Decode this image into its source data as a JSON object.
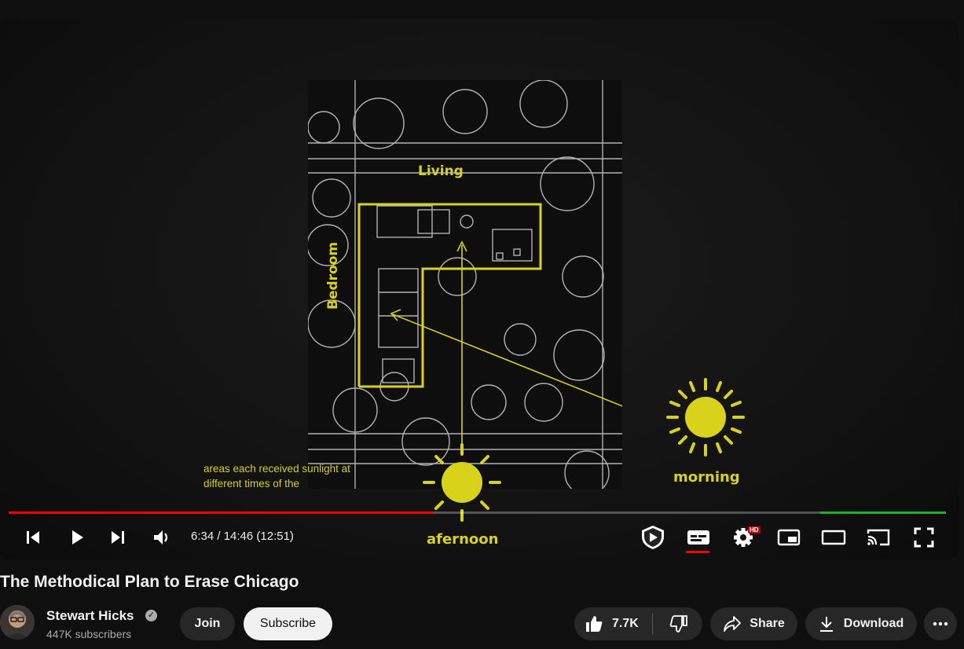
{
  "video": {
    "caption_line1": "areas each received sunlight at",
    "caption_line2": "different times of the",
    "labels": {
      "living": "Living",
      "bedroom": "Bedroom",
      "morning": "morning",
      "afternoon": "afernoon"
    }
  },
  "player": {
    "progress_fraction": 0.4538,
    "time_display": "6:34 / 14:46 (12:51)",
    "hd_badge": "HD",
    "colors": {
      "progress": "#ff0000",
      "chapter": "#1db31d",
      "accent_yellow": "#d9d21a"
    }
  },
  "meta": {
    "title": "The Methodical Plan to Erase Chicago",
    "channel_name": "Stewart Hicks",
    "subscribers": "447K subscribers",
    "join_label": "Join",
    "subscribe_label": "Subscribe",
    "likes": "7.7K",
    "share_label": "Share",
    "download_label": "Download"
  }
}
